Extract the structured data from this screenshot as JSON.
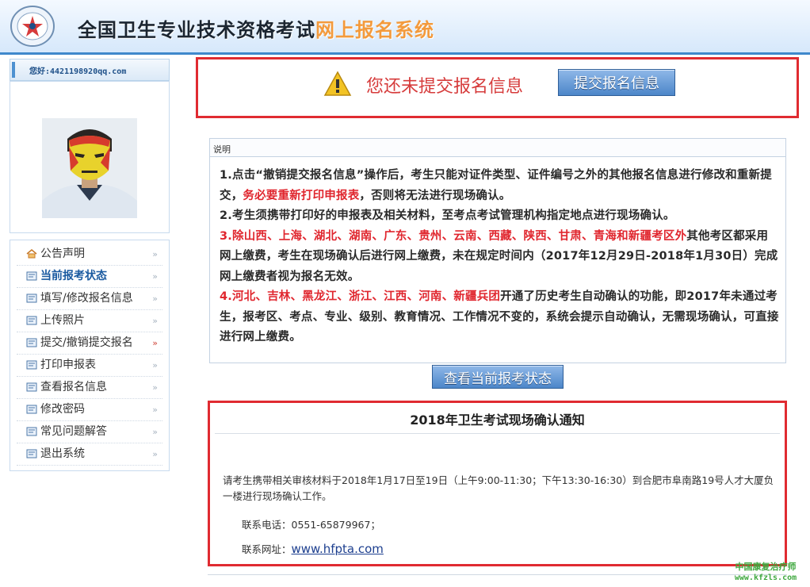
{
  "header": {
    "title_main": "全国卫生专业技术资格考试",
    "title_accent": "网上报名系统"
  },
  "sidebar": {
    "greeting": "您好:4421198920qq.com",
    "menu": [
      {
        "label": "公告声明",
        "icon": "home-icon"
      },
      {
        "label": "当前报考状态",
        "icon": "doc-icon"
      },
      {
        "label": "填写/修改报名信息",
        "icon": "doc-icon"
      },
      {
        "label": "上传照片",
        "icon": "doc-icon"
      },
      {
        "label": "提交/撤销提交报名",
        "icon": "doc-icon"
      },
      {
        "label": "打印申报表",
        "icon": "doc-icon"
      },
      {
        "label": "查看报名信息",
        "icon": "doc-icon"
      },
      {
        "label": "修改密码",
        "icon": "doc-icon"
      },
      {
        "label": "常见问题解答",
        "icon": "doc-icon"
      },
      {
        "label": "退出系统",
        "icon": "doc-icon"
      }
    ]
  },
  "alert": {
    "message": "您还未提交报名信息",
    "button": "提交报名信息"
  },
  "notes": {
    "title": "说明",
    "p1_a": "1.点击“撤销提交报名信息”操作后，考生只能对证件类型、证件编号之外的其他报名信息进行修改和重新提交，",
    "p1_red": "务必要重新打印申报表",
    "p1_b": "，否则将无法进行现场确认。",
    "p2": "2.考生须携带打印好的申报表及相关材料，至考点考试管理机构指定地点进行现场确认。",
    "p3_red": "3.除山西、上海、湖北、湖南、广东、贵州、云南、西藏、陕西、甘肃、青海和新疆考区外",
    "p3_b": "其他考区都采用网上缴费，考生在现场确认后进行网上缴费，未在规定时间内（2017年12月29日-2018年1月30日）完成网上缴费者视为报名无效。",
    "p4_red": "4.河北、吉林、黑龙江、浙江、江西、河南、新疆兵团",
    "p4_b": "开通了历史考生自动确认的功能，即2017年未通过考生，报考区、考点、专业、级别、教育情况、工作情况不变的，系统会提示自动确认，无需现场确认，可直接进行网上缴费。"
  },
  "status_button": "查看当前报考状态",
  "notice": {
    "title": "2018年卫生考试现场确认通知",
    "paragraph": "请考生携带相关审核材料于2018年1月17日至19日（上午9:00-11:30；下午13:30-16:30）到合肥市阜南路19号人才大厦负一楼进行现场确认工作。",
    "phone": "联系电话：0551-65879967；",
    "web_label": "联系网址：",
    "web_link": "www.hfpta.com"
  },
  "watermark": {
    "line1": "中国康复治疗师",
    "line2": "www.kfzls.com"
  },
  "colors": {
    "alert_red": "#e02b31",
    "header_border": "#3f88cc",
    "button_blue": "#4c86c9",
    "watermark_green": "#3fa83f"
  }
}
